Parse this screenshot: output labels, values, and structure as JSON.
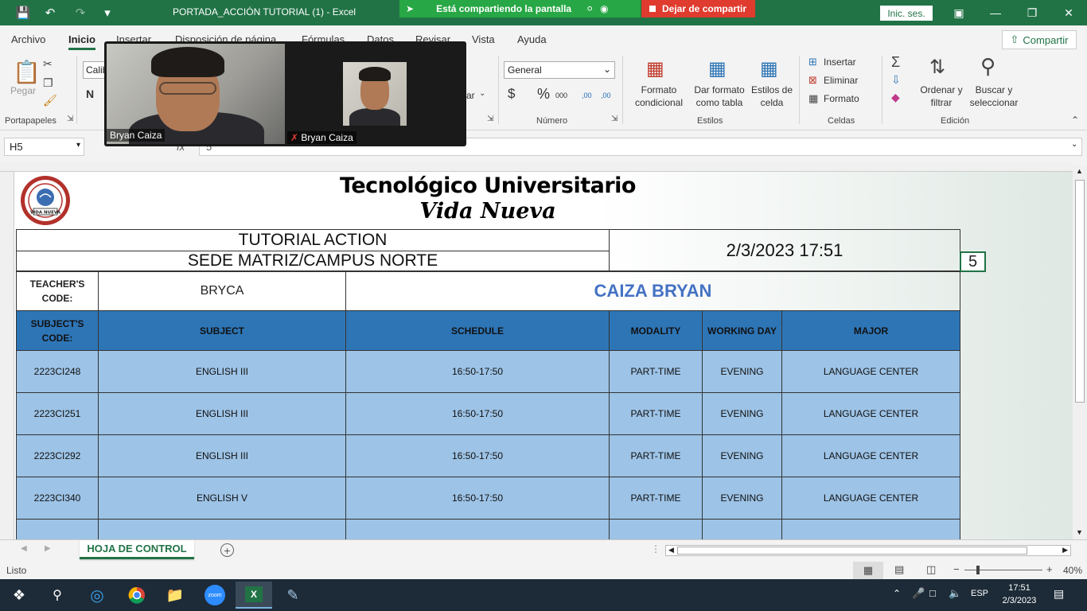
{
  "window": {
    "title": "PORTADA_ACCIÓN TUTORIAL  (1)  -  Excel",
    "share_status": "Está compartiendo la pantalla",
    "stop_share": "Dejar de compartir",
    "signin": "Inic. ses."
  },
  "menu": {
    "tabs": [
      "Archivo",
      "Inicio",
      "Insertar",
      "Disposición de página",
      "Fórmulas",
      "Datos",
      "Revisar",
      "Vista",
      "Ayuda"
    ],
    "share": "Compartir"
  },
  "ribbon": {
    "paste": "Pegar",
    "clipboard": "Portapapeles",
    "font_name": "Calib",
    "bold": "N",
    "number_format": "General",
    "number_group": "Número",
    "conditional_format": "Formato condicional",
    "format_as_table": "Dar formato como tabla",
    "cell_styles": "Estilos de celda",
    "styles_group": "Estilos",
    "insert": "Insertar",
    "delete": "Eliminar",
    "format": "Formato",
    "cells_group": "Celdas",
    "sort_filter": "Ordenar y filtrar",
    "find_select": "Buscar y seleccionar",
    "editing_group": "Edición",
    "currency": "$",
    "percent": "%",
    "thousands": "000",
    "dec_inc": ",00",
    "dec_dec": ",00",
    "partial_label": "ar"
  },
  "video": {
    "main_name": "Bryan Caiza",
    "small_name": "Bryan Caiza"
  },
  "formula": {
    "cell_ref": "H5",
    "fx": "fx",
    "value": "5"
  },
  "sheet": {
    "institution": "Tecnológico Universitario",
    "institution_sub": "Vida Nueva",
    "logo_text": "VIDA NUEVA",
    "title": "TUTORIAL ACTION",
    "campus": "SEDE MATRIZ/CAMPUS NORTE",
    "datetime": "2/3/2023 17:51",
    "h5_value": "5",
    "teacher_code_label": "TEACHER'S CODE:",
    "teacher_code": "BRYCA",
    "teacher_name": "CAIZA BRYAN",
    "headers": [
      "SUBJECT'S CODE:",
      "SUBJECT",
      "SCHEDULE",
      "MODALITY",
      "WORKING DAY",
      "MAJOR"
    ],
    "rows": [
      [
        "2223CI248",
        "ENGLISH III",
        "16:50-17:50",
        "PART-TIME",
        "EVENING",
        "LANGUAGE CENTER"
      ],
      [
        "2223CI251",
        "ENGLISH III",
        "16:50-17:50",
        "PART-TIME",
        "EVENING",
        "LANGUAGE CENTER"
      ],
      [
        "2223CI292",
        "ENGLISH III",
        "16:50-17:50",
        "PART-TIME",
        "EVENING",
        "LANGUAGE CENTER"
      ],
      [
        "2223CI340",
        "ENGLISH V",
        "16:50-17:50",
        "PART-TIME",
        "EVENING",
        "LANGUAGE CENTER"
      ]
    ]
  },
  "tabs": {
    "sheet_name": "HOJA DE CONTROL",
    "add": "+"
  },
  "status": {
    "ready": "Listo",
    "zoom": "40%",
    "zoom_minus": "−",
    "zoom_plus": "+"
  },
  "taskbar": {
    "lang": "ESP",
    "time": "17:51",
    "date": "2/3/2023",
    "zoom_label": "zoom"
  },
  "colors": {
    "excel_green": "#217346",
    "header_blue": "#2e75b6",
    "row_blue": "#9dc3e6",
    "name_blue": "#4472c4"
  }
}
